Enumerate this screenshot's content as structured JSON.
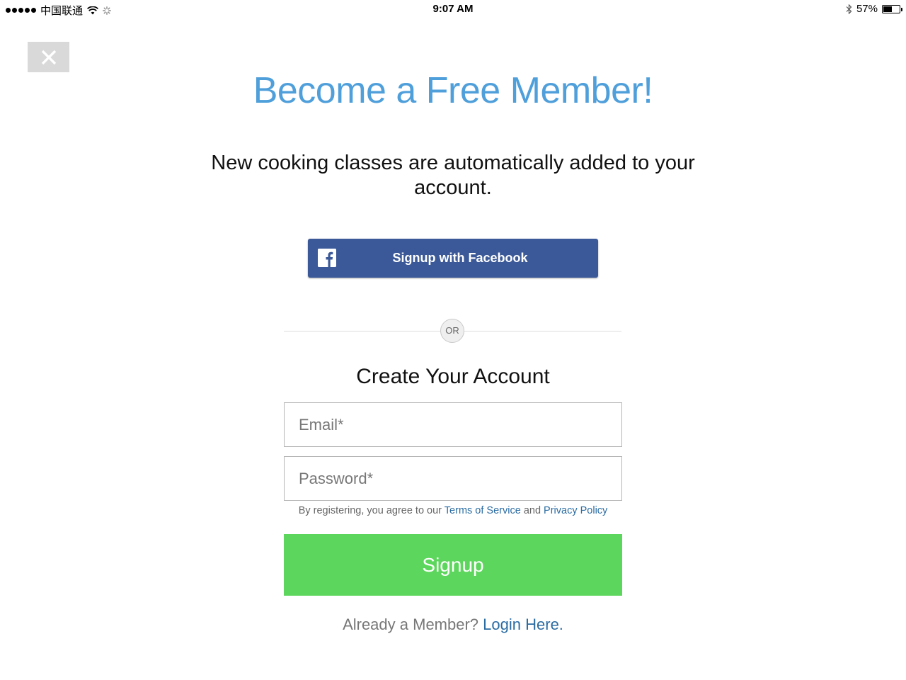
{
  "status_bar": {
    "carrier": "中国联通",
    "time": "9:07 AM",
    "battery_percent": "57%",
    "battery_level": 0.57,
    "icons": [
      "signal-dots-icon",
      "wifi-icon",
      "activity-spinner-icon",
      "bluetooth-icon",
      "battery-icon"
    ]
  },
  "close_button": {
    "icon": "close-icon"
  },
  "header": {
    "title": "Become a Free Member!",
    "subtitle": "New cooking classes are automatically added to your account."
  },
  "facebook": {
    "icon": "facebook-icon",
    "label": "Signup with Facebook",
    "color": "#3b5998"
  },
  "divider": {
    "or_label": "OR"
  },
  "form": {
    "title": "Create Your Account",
    "email_placeholder": "Email*",
    "email_value": "",
    "password_placeholder": "Password*",
    "password_value": "",
    "terms_prefix": "By registering, you agree to our",
    "terms_link": "Terms of Service",
    "terms_and": "and",
    "privacy_link": "Privacy Policy",
    "submit_label": "Signup",
    "submit_color": "#5cd65c"
  },
  "footer": {
    "already_text": "Already a Member?",
    "login_link": "Login Here."
  },
  "colors": {
    "title": "#4f9fdb",
    "link": "#2b6ca3"
  }
}
